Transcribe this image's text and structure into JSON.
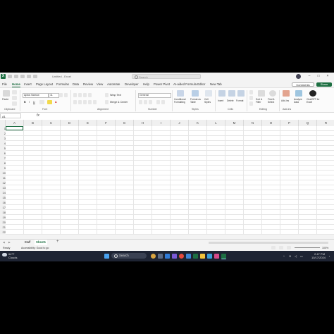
{
  "window": {
    "filename": "Untitled - Excel",
    "search_placeholder": "Search"
  },
  "menu": {
    "tabs": [
      "File",
      "Home",
      "Insert",
      "Page Layout",
      "Formulas",
      "Data",
      "Review",
      "View",
      "Automate",
      "Developer",
      "Help",
      "Power Pivot",
      "AI-aided Formula Editor",
      "New Tab"
    ],
    "active": "Home",
    "comments": "Comments",
    "share": "Share"
  },
  "ribbon": {
    "paste": "Paste",
    "font_name": "Aptos Narrow",
    "font_size": "11",
    "wrap_text": "Wrap Text",
    "merge_center": "Merge & Center",
    "number_format": "General",
    "conditional_formatting": "Conditional Formatting",
    "format_as_table": "Format as Table",
    "cell_styles": "Cell Styles",
    "insert": "Insert",
    "delete": "Delete",
    "format": "Format",
    "sort_filter": "Sort & Filter",
    "find_select": "Find & Select",
    "add_ins": "Add-ins",
    "analyze_data": "Analyze Data",
    "chatgpt": "ChatGPT for Excel",
    "groups": [
      "Clipboard",
      "Font",
      "Alignment",
      "Number",
      "Styles",
      "Cells",
      "Editing",
      "Add-ins"
    ]
  },
  "formula_bar": {
    "name_box": "A1",
    "fx": "fx"
  },
  "columns": [
    "A",
    "B",
    "C",
    "D",
    "E",
    "F",
    "G",
    "H",
    "I",
    "J",
    "K",
    "L",
    "M",
    "N",
    "O",
    "P",
    "Q",
    "R"
  ],
  "rows": [
    "1",
    "2",
    "3",
    "4",
    "5",
    "6",
    "7",
    "8",
    "9",
    "10",
    "11",
    "12",
    "13",
    "14",
    "15",
    "16",
    "17",
    "18",
    "19",
    "20",
    "21",
    "22"
  ],
  "sheets": [
    "Staff",
    "Sheet1"
  ],
  "active_sheet": "Sheet1",
  "status": {
    "ready": "Ready",
    "accessibility": "Accessibility: Good to go",
    "zoom": "100%"
  },
  "taskbar": {
    "weather_temp": "64°F",
    "weather_desc": "Clouds",
    "search": "Search",
    "time": "2:47 PM",
    "date": "10/17/2024"
  },
  "colors": {
    "excel_green": "#1d6f42",
    "taskbar_bg": "#1e2433"
  }
}
